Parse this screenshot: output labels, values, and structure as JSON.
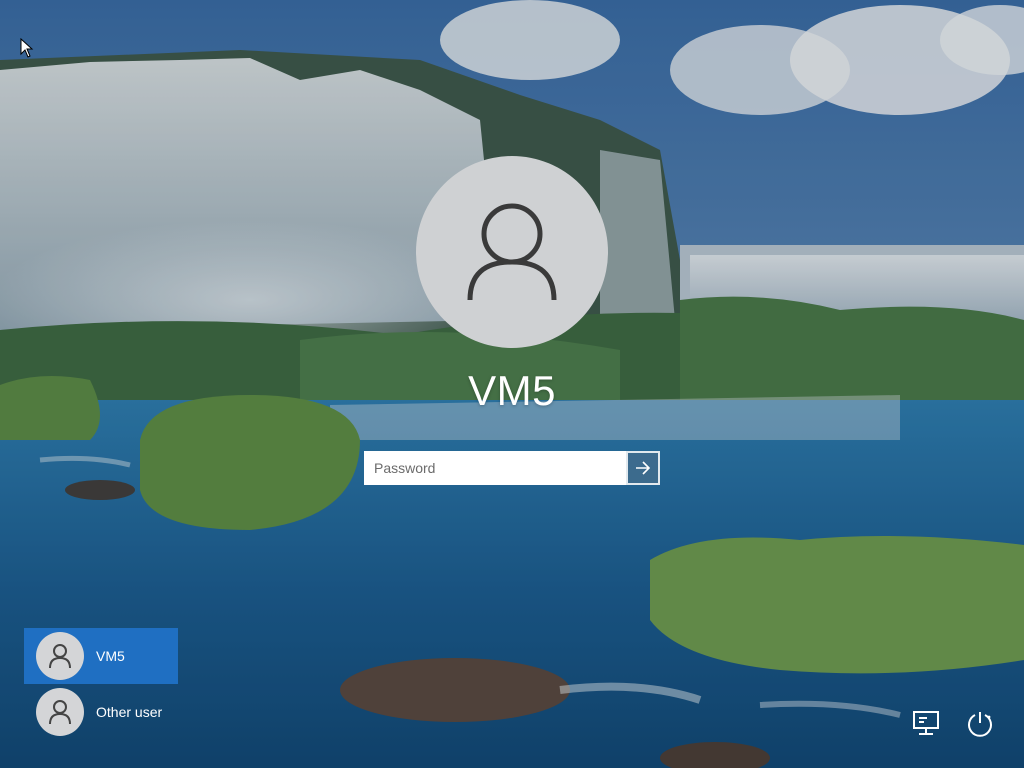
{
  "window": {
    "type": "Windows lock screen"
  },
  "login": {
    "username": "VM5",
    "avatar_icon": "user-icon",
    "password_placeholder": "Password",
    "password_value": "",
    "submit_icon": "arrow-right-icon"
  },
  "users": [
    {
      "name": "VM5",
      "selected": true,
      "icon": "user-icon"
    },
    {
      "name": "Other user",
      "selected": false,
      "icon": "user-icon"
    }
  ],
  "corner": {
    "network_icon": "network-icon",
    "power_icon": "power-icon"
  },
  "colors": {
    "selected_user_bg": "#1f6fc2",
    "avatar_bg": "#cfd1d3",
    "submit_bg": "#466e8c"
  }
}
